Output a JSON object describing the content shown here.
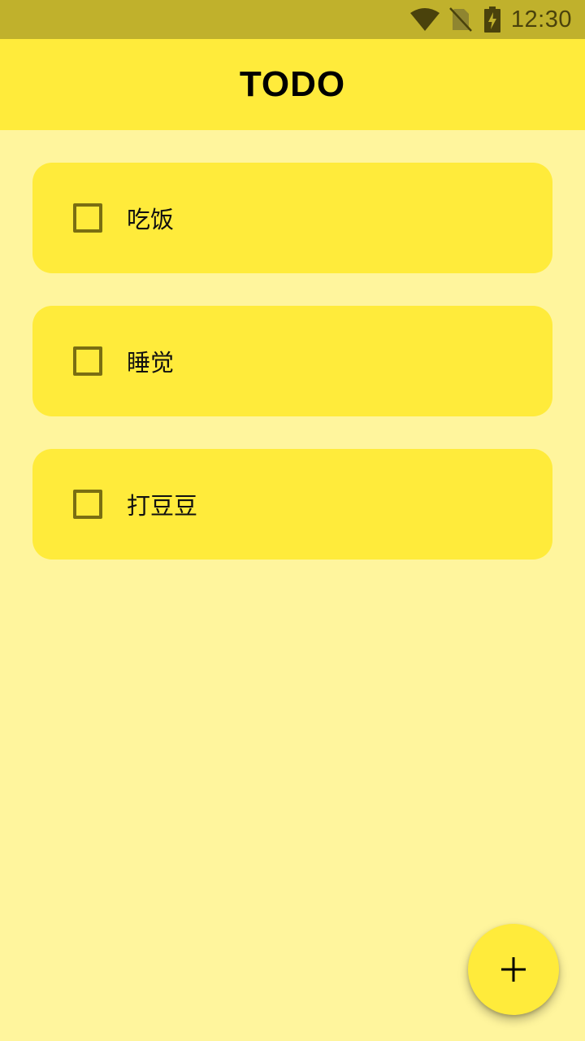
{
  "status_bar": {
    "time": "12:30",
    "icons": [
      "wifi-icon",
      "no-sim-icon",
      "battery-charging-icon"
    ]
  },
  "app_bar": {
    "title": "TODO"
  },
  "todos": [
    {
      "label": "吃饭",
      "checked": false
    },
    {
      "label": "睡觉",
      "checked": false
    },
    {
      "label": "打豆豆",
      "checked": false
    }
  ],
  "fab": {
    "icon": "plus-icon"
  },
  "colors": {
    "status_bar": "#C0B12C",
    "app_bar": "#FFEB3B",
    "background": "#FFF59D",
    "card": "#FFEB3B",
    "checkbox_border": "#7a6e12"
  }
}
